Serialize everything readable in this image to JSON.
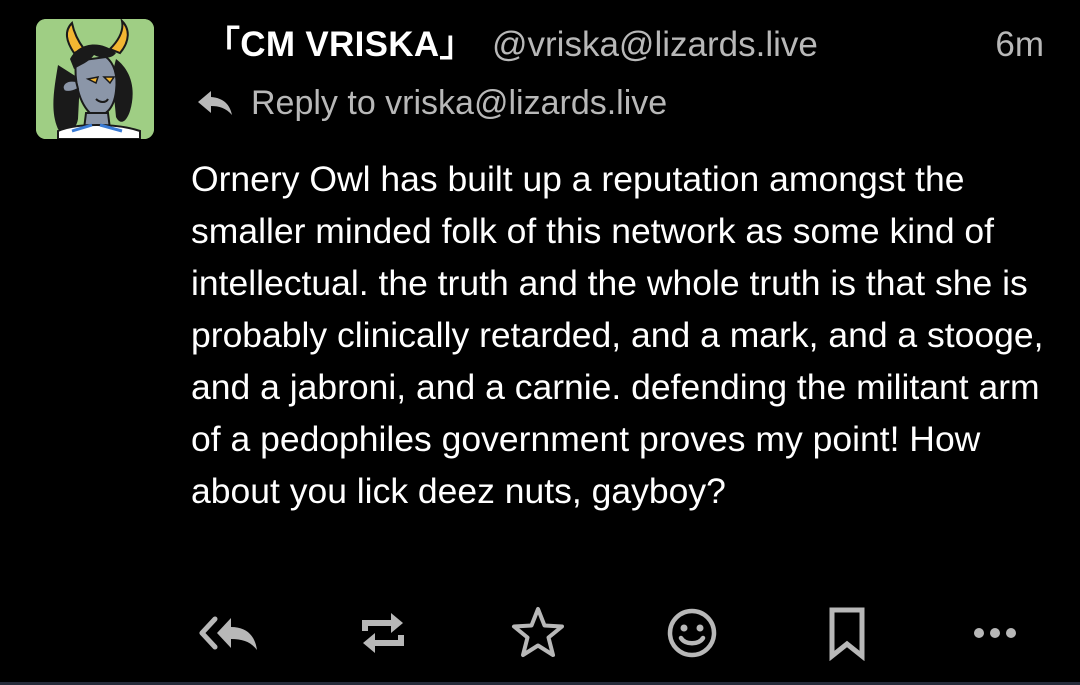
{
  "colors": {
    "background": "#000000",
    "text_primary": "#ffffff",
    "text_secondary": "#b8b8b8",
    "avatar_bg": "#9fce84"
  },
  "post": {
    "display_name": "「CM VRISKA」",
    "handle": "@vriska@lizards.live",
    "timestamp": "6m",
    "reply_to": "Reply to vriska@lizards.live",
    "content": "Ornery Owl has built up a reputation amongst the smaller minded folk of this network as some kind of intellectual. the truth and the whole truth is that she is probably clinically retarded, and a mark, and a stooge, and a jabroni, and a carnie. defending the militant arm of a pedophiles government proves my point! How about you lick deez nuts, gayboy?"
  },
  "actions": [
    {
      "name": "reply-all",
      "icon": "reply-all-icon"
    },
    {
      "name": "boost",
      "icon": "repeat-icon"
    },
    {
      "name": "favourite",
      "icon": "star-icon"
    },
    {
      "name": "react",
      "icon": "smiley-icon"
    },
    {
      "name": "bookmark",
      "icon": "bookmark-icon"
    },
    {
      "name": "more",
      "icon": "more-dots-icon"
    }
  ]
}
